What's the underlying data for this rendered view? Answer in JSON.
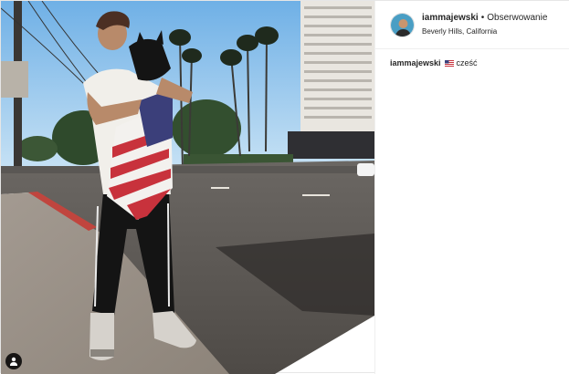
{
  "post": {
    "username": "iammajewski",
    "separator": "•",
    "follow_label": "Obserwowanie",
    "location": "Beverly Hills, California",
    "comments": [
      {
        "username": "iammajewski",
        "emoji": "flag-us-icon",
        "text": "cześć"
      }
    ]
  },
  "colors": {
    "sky": "#8cc2ec",
    "text": "#262626",
    "border": "#efefef",
    "flag_red": "#c8323c",
    "flag_blue": "#3b3f7a"
  }
}
